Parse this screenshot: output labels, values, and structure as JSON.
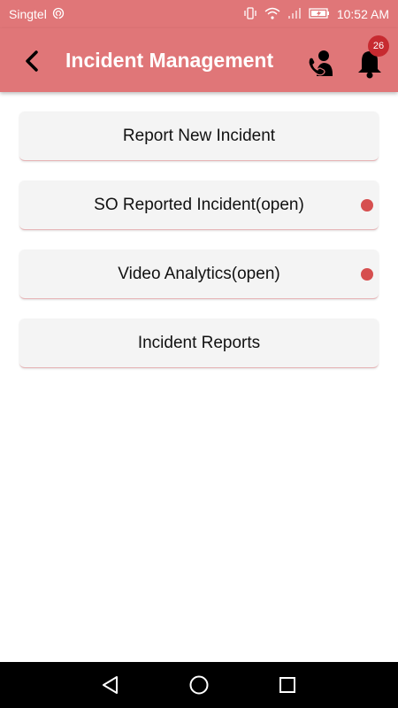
{
  "status_bar": {
    "carrier": "Singtel",
    "time": "10:52 AM",
    "icons": [
      "hotspot-icon",
      "vibrate-icon",
      "wifi-icon",
      "signal-icon",
      "battery-icon"
    ]
  },
  "header": {
    "title": "Incident Management",
    "notification_count": "26",
    "background": "#e07678",
    "badge_color": "#c72a30"
  },
  "menu": {
    "items": [
      {
        "label": "Report New Incident",
        "has_dot": false
      },
      {
        "label": "SO Reported Incident(open)",
        "has_dot": true
      },
      {
        "label": "Video Analytics(open)",
        "has_dot": true
      },
      {
        "label": "Incident Reports",
        "has_dot": false
      }
    ],
    "dot_color": "#d64f4f"
  },
  "nav_bar": {
    "icons": [
      "back-triangle-icon",
      "home-circle-icon",
      "recents-square-icon"
    ]
  }
}
